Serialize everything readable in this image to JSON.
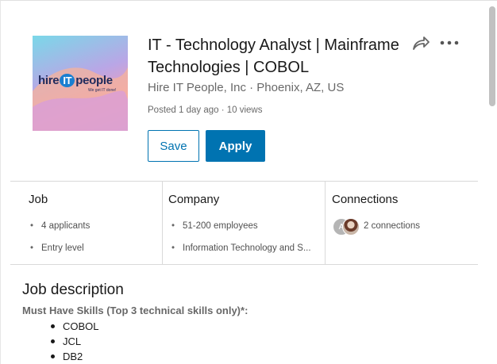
{
  "job": {
    "title": "IT - Technology Analyst | Mainframe Technologies | COBOL",
    "company_location": "Hire IT People, Inc · Phoenix, AZ, US",
    "posted_meta": "Posted 1 day ago · 10 views",
    "logo": {
      "text_before": "hire",
      "text_it": "IT",
      "text_after": "people",
      "tagline": "We get IT done!"
    }
  },
  "actions": {
    "save_label": "Save",
    "apply_label": "Apply",
    "share_icon": "share-arrow-icon",
    "more_icon": "more-dots-icon"
  },
  "insights": {
    "job": {
      "heading": "Job",
      "items": [
        "4 applicants",
        "Entry level"
      ]
    },
    "company": {
      "heading": "Company",
      "items": [
        "51-200 employees",
        "Information Technology and S..."
      ]
    },
    "connections": {
      "heading": "Connections",
      "avatar_initial": "A",
      "text": "2 connections"
    }
  },
  "description": {
    "heading": "Job description",
    "skills_heading": "Must Have Skills (Top 3 technical skills only)*:",
    "skills": [
      "COBOL",
      "JCL",
      "DB2"
    ]
  },
  "colors": {
    "accent": "#0073b1",
    "divider": "#d9d9d9"
  }
}
